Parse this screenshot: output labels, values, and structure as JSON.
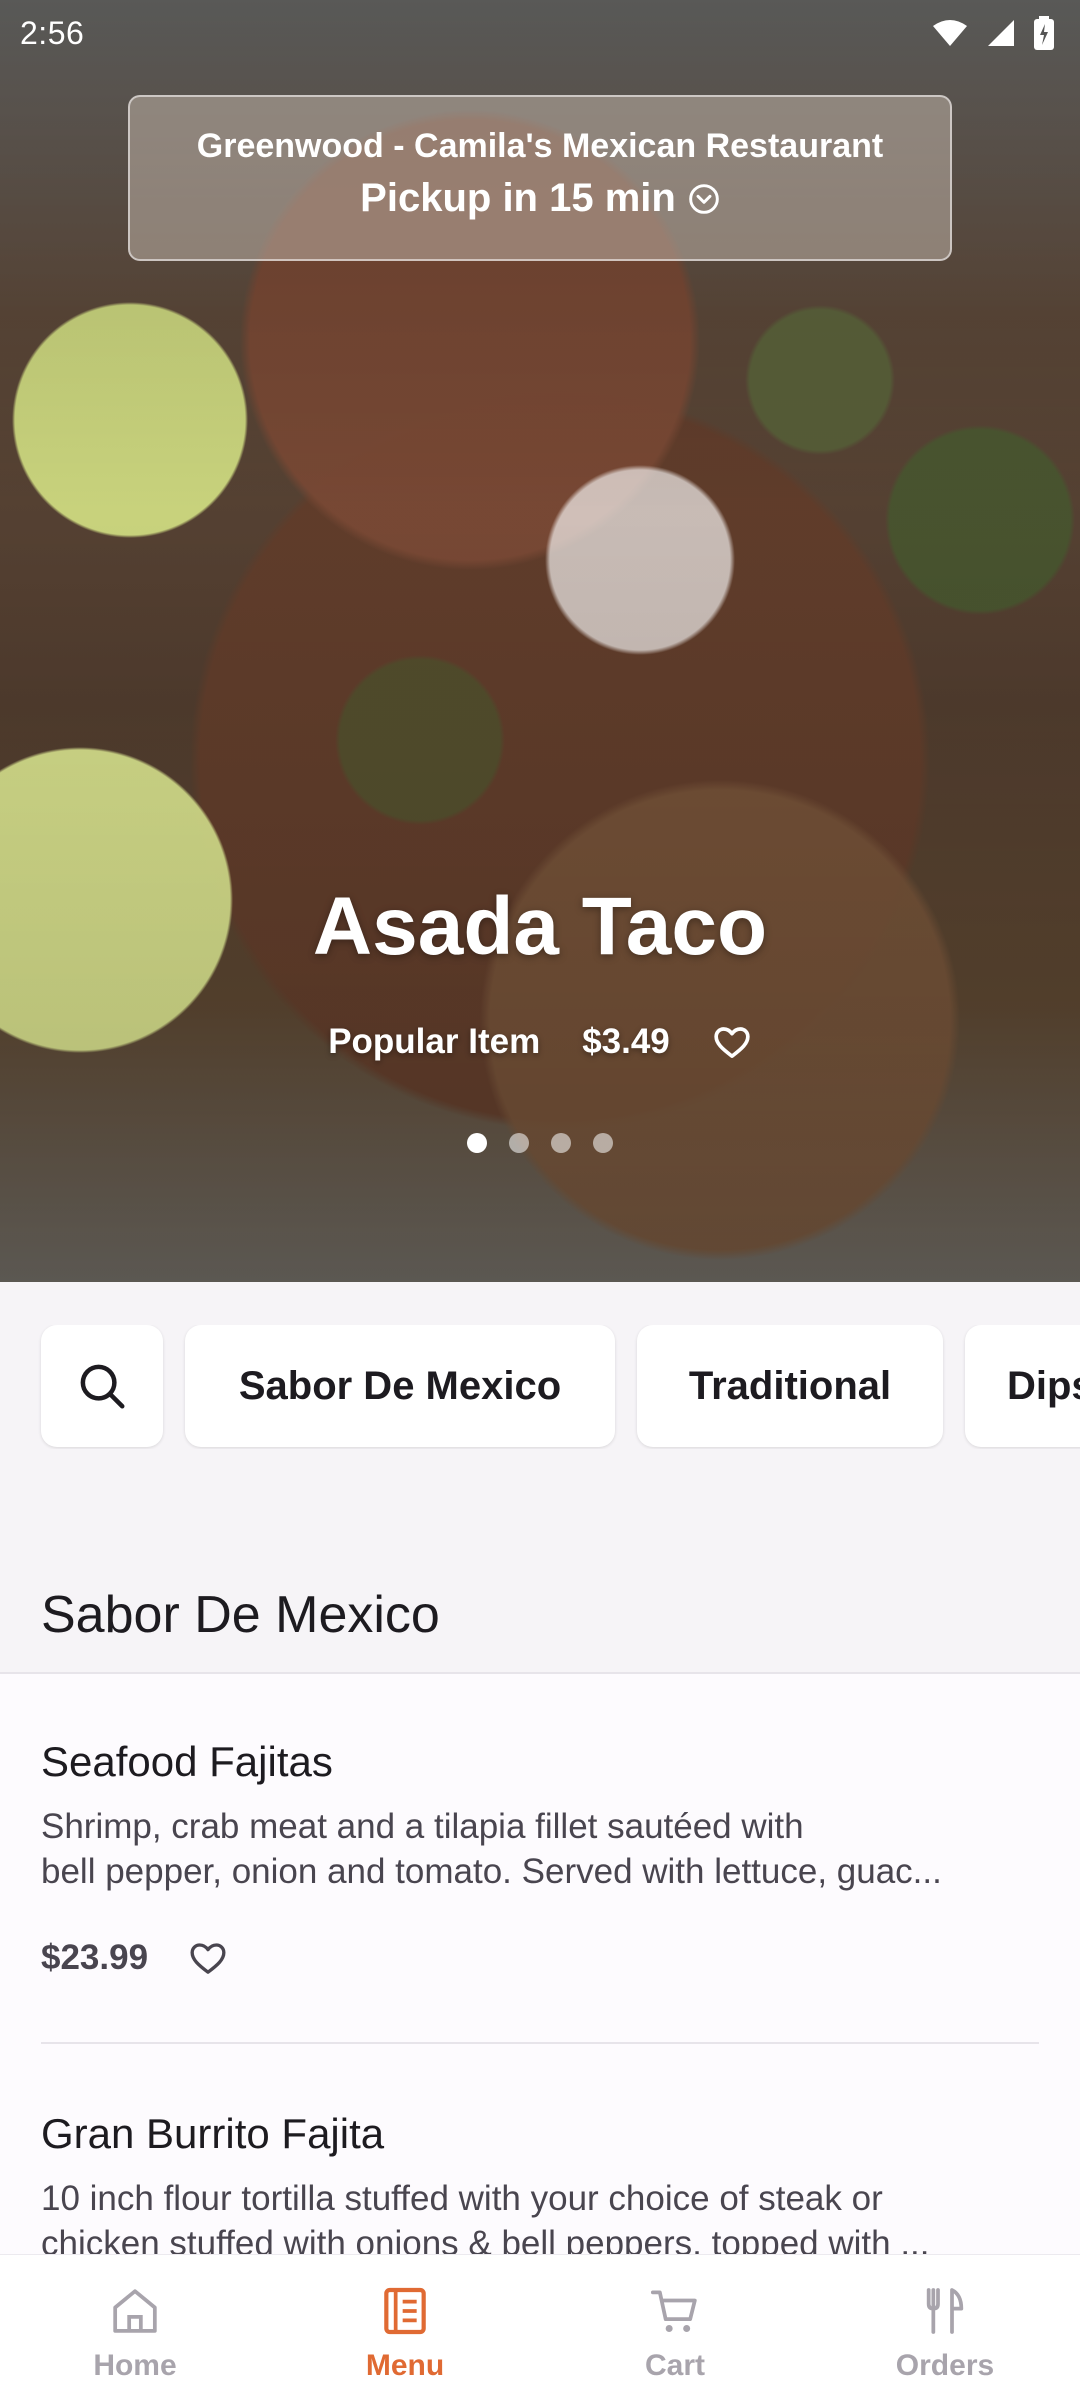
{
  "status_bar": {
    "time": "2:56"
  },
  "restaurant": {
    "name": "Greenwood - Camila's Mexican Restaurant",
    "pickup": "Pickup in 15 min"
  },
  "hero": {
    "title": "Asada Taco",
    "badge": "Popular Item",
    "price": "$3.49",
    "carousel": {
      "pages": 4,
      "active_index": 0
    }
  },
  "categories": [
    "Sabor De Mexico",
    "Traditional",
    "Dips"
  ],
  "section": {
    "title": "Sabor De Mexico"
  },
  "items": [
    {
      "name": "Seafood Fajitas",
      "description_line1": "Shrimp, crab meat and a tilapia fillet sautéed with",
      "description_line2": "bell pepper, onion and tomato. Served with lettuce, guac...",
      "price": "$23.99"
    },
    {
      "name": "Gran Burrito Fajita",
      "description_line1": "10 inch flour tortilla stuffed with your choice of steak or",
      "description_line2": "chicken stuffed with onions & bell peppers, topped with ..."
    }
  ],
  "nav": {
    "items": [
      {
        "label": "Home",
        "icon": "home-icon"
      },
      {
        "label": "Menu",
        "icon": "menu-icon"
      },
      {
        "label": "Cart",
        "icon": "cart-icon"
      },
      {
        "label": "Orders",
        "icon": "orders-icon"
      }
    ],
    "active": "Menu"
  },
  "colors": {
    "accent": "#e06a33",
    "inactive": "#a8a4ac"
  }
}
